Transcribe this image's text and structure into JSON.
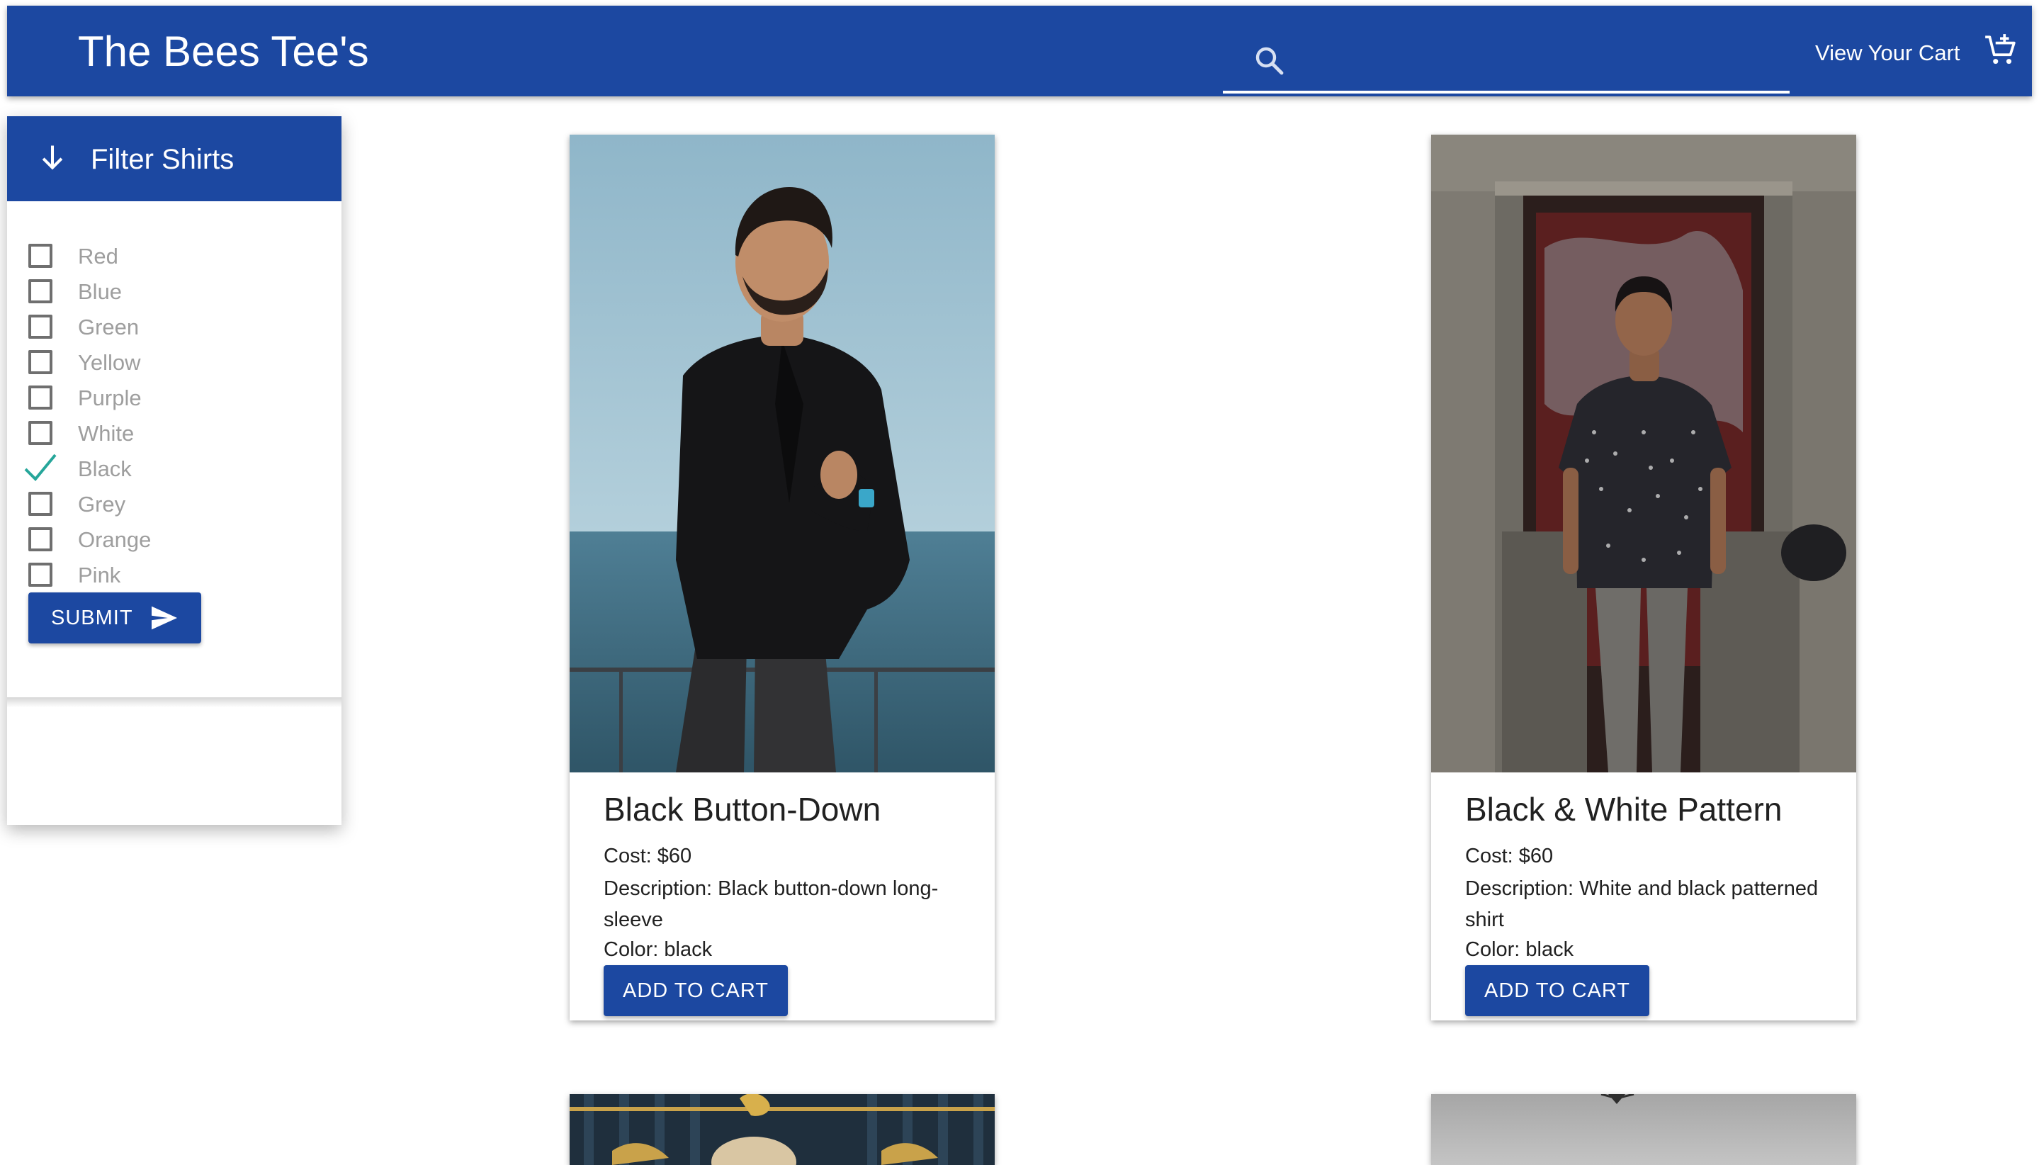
{
  "header": {
    "brand": "The Bees Tee's",
    "search_placeholder": "",
    "cart_link": "View Your Cart",
    "bar_color": "#1c48a1"
  },
  "filter": {
    "title": "Filter Shirts",
    "options": [
      {
        "label": "Red",
        "checked": false
      },
      {
        "label": "Blue",
        "checked": false
      },
      {
        "label": "Green",
        "checked": false
      },
      {
        "label": "Yellow",
        "checked": false
      },
      {
        "label": "Purple",
        "checked": false
      },
      {
        "label": "White",
        "checked": false
      },
      {
        "label": "Black",
        "checked": true
      },
      {
        "label": "Grey",
        "checked": false
      },
      {
        "label": "Orange",
        "checked": false
      },
      {
        "label": "Pink",
        "checked": false
      }
    ],
    "submit_label": "SUBMIT"
  },
  "products": [
    {
      "title": "Black Button-Down",
      "cost": "Cost: $60",
      "description": "Description: Black button-down long-sleeve",
      "color": "Color: black",
      "button_label": "ADD TO CART",
      "image": "man-in-black-shirt-by-the-sea"
    },
    {
      "title": "Black & White Pattern",
      "cost": "Cost: $60",
      "description": "Description: White and black patterned shirt",
      "color": "Color: black",
      "button_label": "ADD TO CART",
      "image": "man-in-patterned-shirt-in-stone-doorway"
    }
  ],
  "icons": {
    "search": "search-icon",
    "cart": "add-shopping-cart-icon",
    "filter_toggle": "arrow-down-icon",
    "submit": "send-icon",
    "checked": "check-icon"
  },
  "colors": {
    "primary": "#1c48a1",
    "check": "#26a69a",
    "label_grey": "#9e9e9e"
  }
}
